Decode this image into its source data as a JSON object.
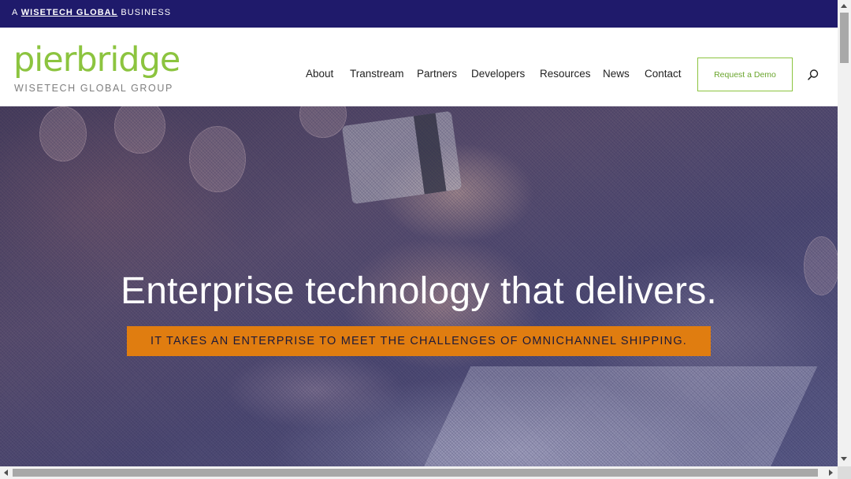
{
  "topbar": {
    "prefix": "A",
    "brand": "WISETECH GLOBAL",
    "suffix": "BUSINESS"
  },
  "logo": {
    "word": "pierbridge",
    "subtitle": "WISETECH GLOBAL GROUP",
    "color": "#8cc43f"
  },
  "nav": {
    "items": [
      {
        "label": "About"
      },
      {
        "label": "Transtream"
      },
      {
        "label": "Partners"
      },
      {
        "label": "Developers"
      },
      {
        "label": "Resources"
      },
      {
        "label": "News"
      },
      {
        "label": "Contact"
      }
    ],
    "cta_label": "Request a Demo",
    "search_icon": "search-icon"
  },
  "hero": {
    "title": "Enterprise technology that delivers.",
    "tagline": "IT TAKES AN ENTERPRISE TO MEET THE CHALLENGES OF OMNICHANNEL SHIPPING.",
    "tagline_bg": "#e07d10"
  },
  "colors": {
    "topbar_bg": "#1f1a6b",
    "accent_green": "#8cc43f"
  }
}
